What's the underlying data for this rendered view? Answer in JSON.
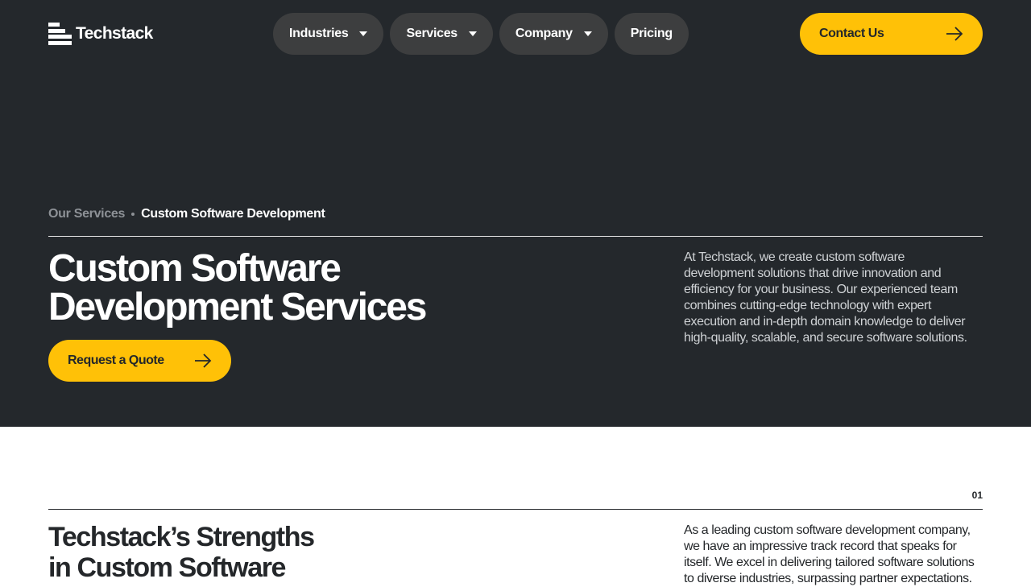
{
  "header": {
    "logo_text": "Techstack",
    "nav": [
      {
        "label": "Industries",
        "has_dropdown": true
      },
      {
        "label": "Services",
        "has_dropdown": true
      },
      {
        "label": "Company",
        "has_dropdown": true
      },
      {
        "label": "Pricing",
        "has_dropdown": false
      }
    ],
    "contact_label": "Contact Us"
  },
  "breadcrumb": {
    "parent": "Our Services",
    "current": "Custom Software Development"
  },
  "hero": {
    "title_lines": [
      "Custom Software",
      "Development Services"
    ],
    "cta_label": "Request a Quote",
    "description_lines": [
      "At Techstack, we create custom software",
      "development solutions that drive innovation and",
      "efficiency for your business. Our experienced team",
      "combines cutting-edge technology with expert",
      "execution and in-depth domain knowledge to deliver",
      "high-quality, scalable, and secure software solutions."
    ]
  },
  "section": {
    "number": "01",
    "title_lines": [
      "Techstack’s Strengths",
      "in Custom Software"
    ],
    "description_lines": [
      "As a leading custom software development company,",
      "we have an impressive track record that speaks for",
      "itself. We excel in delivering tailored software solutions",
      "to diverse industries, surpassing partner expectations."
    ]
  },
  "colors": {
    "hero_bg": "#24282c",
    "accent": "#ffc107",
    "nav_pill_bg": "#3d3e3f"
  },
  "icons": {
    "logo": "stacked-bars-logo-icon",
    "dropdown": "caret-down-icon",
    "cta": "arrow-right-icon"
  }
}
